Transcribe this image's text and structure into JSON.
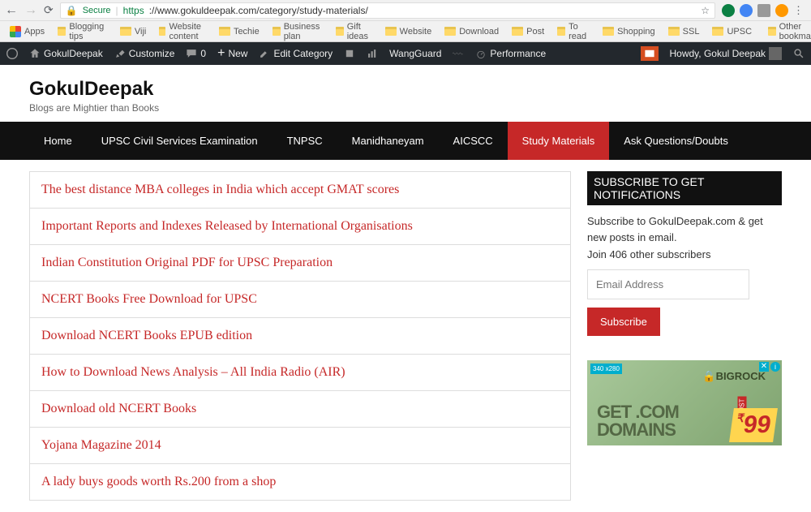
{
  "browser": {
    "secure_label": "Secure",
    "url_scheme": "https",
    "url_rest": "://www.gokuldeepak.com/category/study-materials/",
    "other_bookmarks": "Other bookmarks"
  },
  "bookmarks": [
    "Apps",
    "Blogging tips",
    "Viji",
    "Website content",
    "Techie",
    "Business plan",
    "Gift ideas",
    "Website",
    "Download",
    "Post",
    "To read",
    "Shopping",
    "SSL",
    "UPSC"
  ],
  "admin": {
    "site": "GokulDeepak",
    "customize": "Customize",
    "comments": "0",
    "new": "New",
    "edit": "Edit Category",
    "wangguard": "WangGuard",
    "performance": "Performance",
    "howdy": "Howdy, Gokul Deepak"
  },
  "header": {
    "title": "GokulDeepak",
    "tagline": "Blogs are Mightier than Books"
  },
  "nav": [
    {
      "label": "Home"
    },
    {
      "label": "UPSC Civil Services Examination"
    },
    {
      "label": "TNPSC"
    },
    {
      "label": "Manidhaneyam"
    },
    {
      "label": "AICSCC"
    },
    {
      "label": "Study Materials",
      "active": true
    },
    {
      "label": "Ask Questions/Doubts"
    }
  ],
  "posts": [
    "The best distance MBA colleges in India which accept GMAT scores",
    "Important Reports and Indexes Released by International Organisations",
    "Indian Constitution Original PDF for UPSC Preparation",
    "NCERT Books Free Download for UPSC",
    "Download NCERT Books EPUB edition",
    "How to Download News Analysis – All India Radio (AIR)",
    "Download old NCERT Books",
    "Yojana Magazine 2014",
    "A lady buys goods worth Rs.200 from a shop"
  ],
  "sidebar": {
    "widget_title": "SUBSCRIBE TO GET NOTIFICATIONS",
    "desc": "Subscribe to GokulDeepak.com & get new posts in email.",
    "join": "Join 406 other subscribers",
    "placeholder": "Email Address",
    "button": "Subscribe"
  },
  "ad": {
    "badge": "340 x280",
    "logo": "BIGROCK",
    "line1": "GET .COM",
    "line2": "DOMAINS",
    "just": "JUST",
    "price": "99",
    "currency": "₹"
  }
}
